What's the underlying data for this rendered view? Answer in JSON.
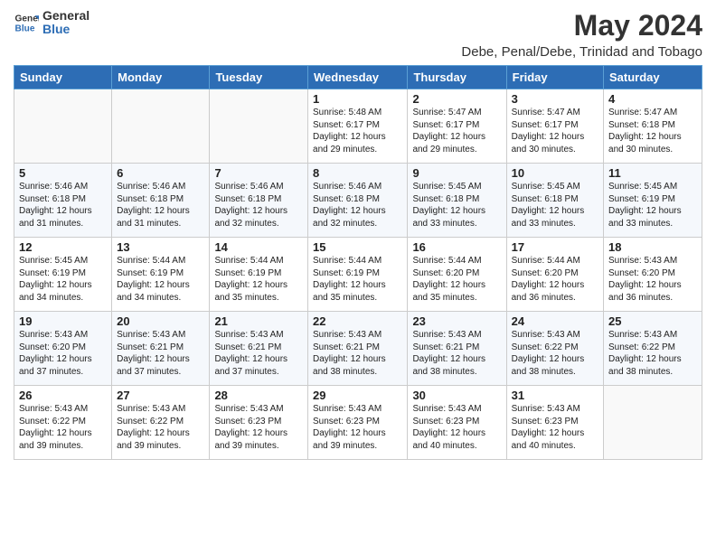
{
  "header": {
    "logo_line1": "General",
    "logo_line2": "Blue",
    "month_year": "May 2024",
    "location": "Debe, Penal/Debe, Trinidad and Tobago"
  },
  "weekdays": [
    "Sunday",
    "Monday",
    "Tuesday",
    "Wednesday",
    "Thursday",
    "Friday",
    "Saturday"
  ],
  "weeks": [
    [
      {
        "day": "",
        "info": ""
      },
      {
        "day": "",
        "info": ""
      },
      {
        "day": "",
        "info": ""
      },
      {
        "day": "1",
        "info": "Sunrise: 5:48 AM\nSunset: 6:17 PM\nDaylight: 12 hours\nand 29 minutes."
      },
      {
        "day": "2",
        "info": "Sunrise: 5:47 AM\nSunset: 6:17 PM\nDaylight: 12 hours\nand 29 minutes."
      },
      {
        "day": "3",
        "info": "Sunrise: 5:47 AM\nSunset: 6:17 PM\nDaylight: 12 hours\nand 30 minutes."
      },
      {
        "day": "4",
        "info": "Sunrise: 5:47 AM\nSunset: 6:18 PM\nDaylight: 12 hours\nand 30 minutes."
      }
    ],
    [
      {
        "day": "5",
        "info": "Sunrise: 5:46 AM\nSunset: 6:18 PM\nDaylight: 12 hours\nand 31 minutes."
      },
      {
        "day": "6",
        "info": "Sunrise: 5:46 AM\nSunset: 6:18 PM\nDaylight: 12 hours\nand 31 minutes."
      },
      {
        "day": "7",
        "info": "Sunrise: 5:46 AM\nSunset: 6:18 PM\nDaylight: 12 hours\nand 32 minutes."
      },
      {
        "day": "8",
        "info": "Sunrise: 5:46 AM\nSunset: 6:18 PM\nDaylight: 12 hours\nand 32 minutes."
      },
      {
        "day": "9",
        "info": "Sunrise: 5:45 AM\nSunset: 6:18 PM\nDaylight: 12 hours\nand 33 minutes."
      },
      {
        "day": "10",
        "info": "Sunrise: 5:45 AM\nSunset: 6:18 PM\nDaylight: 12 hours\nand 33 minutes."
      },
      {
        "day": "11",
        "info": "Sunrise: 5:45 AM\nSunset: 6:19 PM\nDaylight: 12 hours\nand 33 minutes."
      }
    ],
    [
      {
        "day": "12",
        "info": "Sunrise: 5:45 AM\nSunset: 6:19 PM\nDaylight: 12 hours\nand 34 minutes."
      },
      {
        "day": "13",
        "info": "Sunrise: 5:44 AM\nSunset: 6:19 PM\nDaylight: 12 hours\nand 34 minutes."
      },
      {
        "day": "14",
        "info": "Sunrise: 5:44 AM\nSunset: 6:19 PM\nDaylight: 12 hours\nand 35 minutes."
      },
      {
        "day": "15",
        "info": "Sunrise: 5:44 AM\nSunset: 6:19 PM\nDaylight: 12 hours\nand 35 minutes."
      },
      {
        "day": "16",
        "info": "Sunrise: 5:44 AM\nSunset: 6:20 PM\nDaylight: 12 hours\nand 35 minutes."
      },
      {
        "day": "17",
        "info": "Sunrise: 5:44 AM\nSunset: 6:20 PM\nDaylight: 12 hours\nand 36 minutes."
      },
      {
        "day": "18",
        "info": "Sunrise: 5:43 AM\nSunset: 6:20 PM\nDaylight: 12 hours\nand 36 minutes."
      }
    ],
    [
      {
        "day": "19",
        "info": "Sunrise: 5:43 AM\nSunset: 6:20 PM\nDaylight: 12 hours\nand 37 minutes."
      },
      {
        "day": "20",
        "info": "Sunrise: 5:43 AM\nSunset: 6:21 PM\nDaylight: 12 hours\nand 37 minutes."
      },
      {
        "day": "21",
        "info": "Sunrise: 5:43 AM\nSunset: 6:21 PM\nDaylight: 12 hours\nand 37 minutes."
      },
      {
        "day": "22",
        "info": "Sunrise: 5:43 AM\nSunset: 6:21 PM\nDaylight: 12 hours\nand 38 minutes."
      },
      {
        "day": "23",
        "info": "Sunrise: 5:43 AM\nSunset: 6:21 PM\nDaylight: 12 hours\nand 38 minutes."
      },
      {
        "day": "24",
        "info": "Sunrise: 5:43 AM\nSunset: 6:22 PM\nDaylight: 12 hours\nand 38 minutes."
      },
      {
        "day": "25",
        "info": "Sunrise: 5:43 AM\nSunset: 6:22 PM\nDaylight: 12 hours\nand 38 minutes."
      }
    ],
    [
      {
        "day": "26",
        "info": "Sunrise: 5:43 AM\nSunset: 6:22 PM\nDaylight: 12 hours\nand 39 minutes."
      },
      {
        "day": "27",
        "info": "Sunrise: 5:43 AM\nSunset: 6:22 PM\nDaylight: 12 hours\nand 39 minutes."
      },
      {
        "day": "28",
        "info": "Sunrise: 5:43 AM\nSunset: 6:23 PM\nDaylight: 12 hours\nand 39 minutes."
      },
      {
        "day": "29",
        "info": "Sunrise: 5:43 AM\nSunset: 6:23 PM\nDaylight: 12 hours\nand 39 minutes."
      },
      {
        "day": "30",
        "info": "Sunrise: 5:43 AM\nSunset: 6:23 PM\nDaylight: 12 hours\nand 40 minutes."
      },
      {
        "day": "31",
        "info": "Sunrise: 5:43 AM\nSunset: 6:23 PM\nDaylight: 12 hours\nand 40 minutes."
      },
      {
        "day": "",
        "info": ""
      }
    ]
  ]
}
